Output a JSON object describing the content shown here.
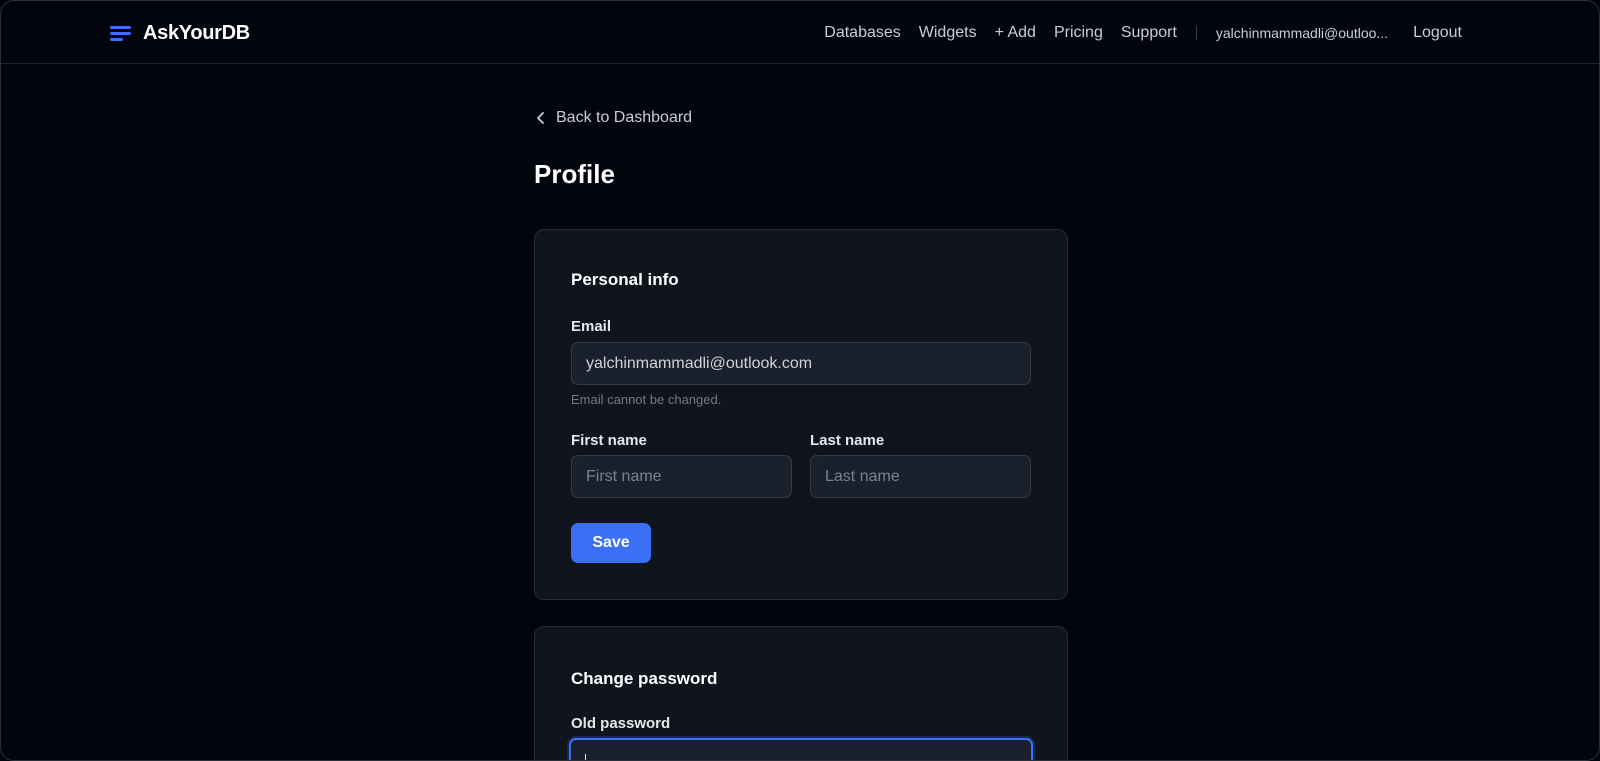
{
  "header": {
    "brand": "AskYourDB",
    "nav": [
      "Databases",
      "Widgets",
      "+ Add",
      "Pricing",
      "Support"
    ],
    "user_email": "yalchinmammadli@outloo...",
    "logout": "Logout"
  },
  "back_link": "Back to Dashboard",
  "page_title": "Profile",
  "personal_info": {
    "title": "Personal info",
    "email_label": "Email",
    "email_value": "yalchinmammadli@outlook.com",
    "email_hint": "Email cannot be changed.",
    "first_name_label": "First name",
    "first_name_placeholder": "First name",
    "last_name_label": "Last name",
    "last_name_placeholder": "Last name",
    "save_label": "Save"
  },
  "change_password": {
    "title": "Change password",
    "old_password_label": "Old password"
  },
  "colors": {
    "accent": "#3b6ff5",
    "background": "#02050d",
    "card": "#0f141d"
  }
}
